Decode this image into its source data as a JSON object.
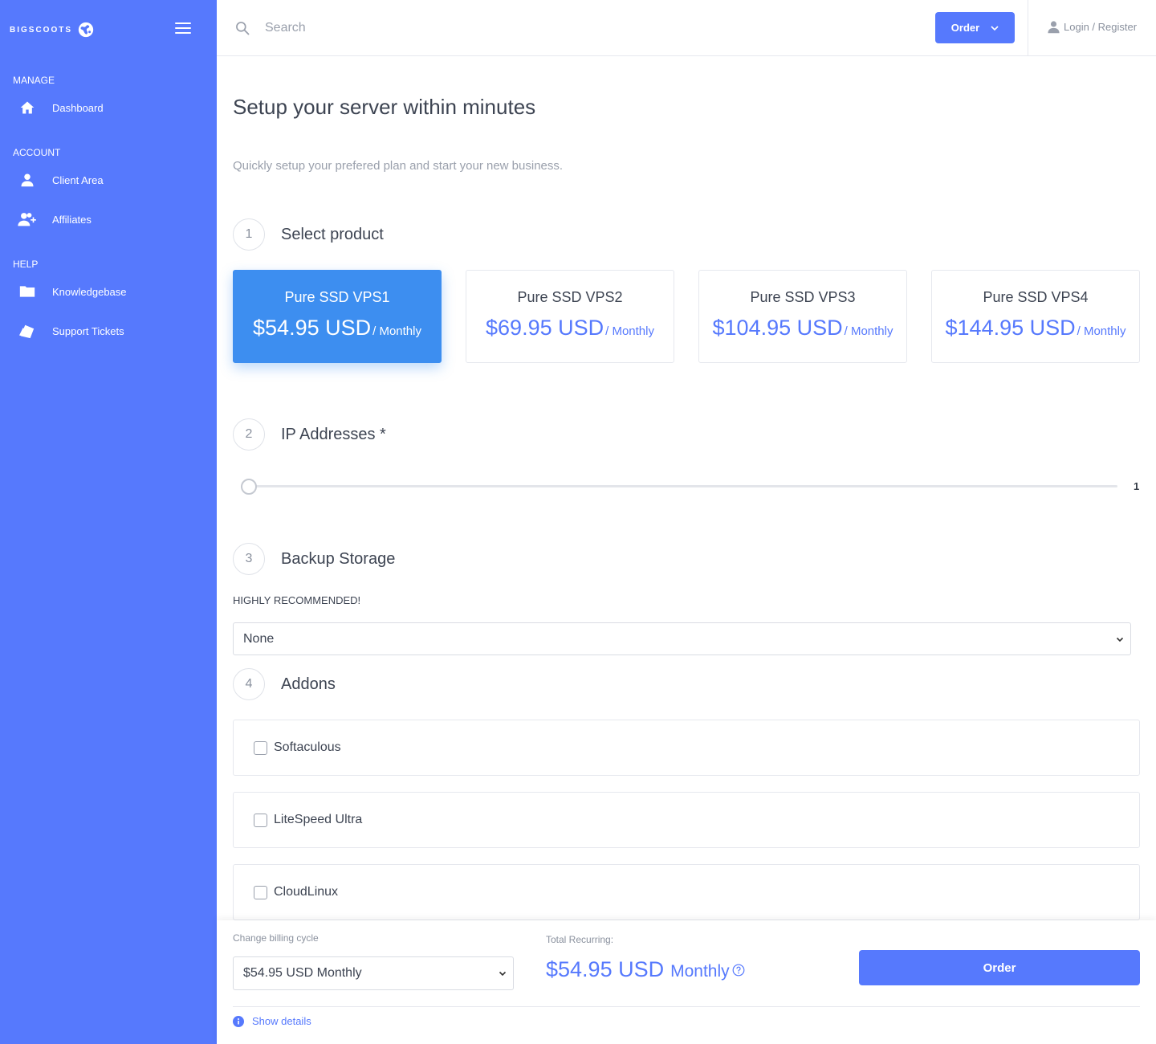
{
  "brand": {
    "name": "BIGSCOOTS"
  },
  "sidebar": {
    "sections": [
      {
        "title": "MANAGE",
        "items": [
          {
            "label": "Dashboard",
            "icon": "home-icon"
          }
        ]
      },
      {
        "title": "ACCOUNT",
        "items": [
          {
            "label": "Client Area",
            "icon": "user-icon"
          },
          {
            "label": "Affiliates",
            "icon": "user-plus-icon"
          }
        ]
      },
      {
        "title": "HELP",
        "items": [
          {
            "label": "Knowledgebase",
            "icon": "folder-icon"
          },
          {
            "label": "Support Tickets",
            "icon": "ticket-icon"
          }
        ]
      }
    ]
  },
  "header": {
    "search_placeholder": "Search",
    "order_label": "Order",
    "login_label": "Login / Register"
  },
  "page": {
    "title": "Setup your server within minutes",
    "subtitle": "Quickly setup your prefered plan and start your new business."
  },
  "steps": [
    {
      "number": "1",
      "title": "Select product"
    },
    {
      "number": "2",
      "title": "IP Addresses *"
    },
    {
      "number": "3",
      "title": "Backup Storage"
    },
    {
      "number": "4",
      "title": "Addons"
    }
  ],
  "plans": [
    {
      "name": "Pure SSD VPS1",
      "price": "$54.95 USD",
      "cycle": "/ Monthly",
      "selected": true
    },
    {
      "name": "Pure SSD VPS2",
      "price": "$69.95 USD",
      "cycle": "/ Monthly",
      "selected": false
    },
    {
      "name": "Pure SSD VPS3",
      "price": "$104.95 USD",
      "cycle": "/ Monthly",
      "selected": false
    },
    {
      "name": "Pure SSD VPS4",
      "price": "$144.95 USD",
      "cycle": "/ Monthly",
      "selected": false
    }
  ],
  "ip_addresses": {
    "value": "1"
  },
  "backup": {
    "note": "HIGHLY RECOMMENDED!",
    "selected": "None"
  },
  "addons": [
    {
      "label": "Softaculous",
      "checked": false
    },
    {
      "label": "LiteSpeed Ultra",
      "checked": false
    },
    {
      "label": "CloudLinux",
      "checked": false
    }
  ],
  "footer": {
    "billing_label": "Change billing cycle",
    "billing_selected": "$54.95 USD Monthly",
    "total_label": "Total Recurring:",
    "total_amount": "$54.95 USD",
    "total_cycle": "Monthly",
    "order_label": "Order",
    "details_label": "Show details"
  },
  "colors": {
    "sidebar": "#5679fd",
    "accent": "#5679fd",
    "selected_plan": "#3d8ef0"
  }
}
